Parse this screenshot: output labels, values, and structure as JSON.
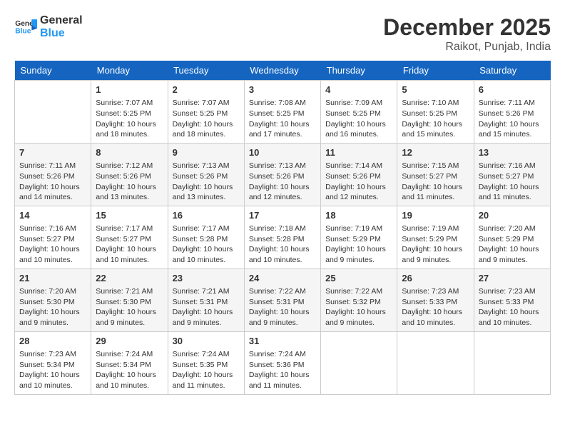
{
  "header": {
    "logo_line1": "General",
    "logo_line2": "Blue",
    "month": "December 2025",
    "location": "Raikot, Punjab, India"
  },
  "weekdays": [
    "Sunday",
    "Monday",
    "Tuesday",
    "Wednesday",
    "Thursday",
    "Friday",
    "Saturday"
  ],
  "weeks": [
    [
      {
        "day": "",
        "info": ""
      },
      {
        "day": "1",
        "info": "Sunrise: 7:07 AM\nSunset: 5:25 PM\nDaylight: 10 hours\nand 18 minutes."
      },
      {
        "day": "2",
        "info": "Sunrise: 7:07 AM\nSunset: 5:25 PM\nDaylight: 10 hours\nand 18 minutes."
      },
      {
        "day": "3",
        "info": "Sunrise: 7:08 AM\nSunset: 5:25 PM\nDaylight: 10 hours\nand 17 minutes."
      },
      {
        "day": "4",
        "info": "Sunrise: 7:09 AM\nSunset: 5:25 PM\nDaylight: 10 hours\nand 16 minutes."
      },
      {
        "day": "5",
        "info": "Sunrise: 7:10 AM\nSunset: 5:25 PM\nDaylight: 10 hours\nand 15 minutes."
      },
      {
        "day": "6",
        "info": "Sunrise: 7:11 AM\nSunset: 5:26 PM\nDaylight: 10 hours\nand 15 minutes."
      }
    ],
    [
      {
        "day": "7",
        "info": "Sunrise: 7:11 AM\nSunset: 5:26 PM\nDaylight: 10 hours\nand 14 minutes."
      },
      {
        "day": "8",
        "info": "Sunrise: 7:12 AM\nSunset: 5:26 PM\nDaylight: 10 hours\nand 13 minutes."
      },
      {
        "day": "9",
        "info": "Sunrise: 7:13 AM\nSunset: 5:26 PM\nDaylight: 10 hours\nand 13 minutes."
      },
      {
        "day": "10",
        "info": "Sunrise: 7:13 AM\nSunset: 5:26 PM\nDaylight: 10 hours\nand 12 minutes."
      },
      {
        "day": "11",
        "info": "Sunrise: 7:14 AM\nSunset: 5:26 PM\nDaylight: 10 hours\nand 12 minutes."
      },
      {
        "day": "12",
        "info": "Sunrise: 7:15 AM\nSunset: 5:27 PM\nDaylight: 10 hours\nand 11 minutes."
      },
      {
        "day": "13",
        "info": "Sunrise: 7:16 AM\nSunset: 5:27 PM\nDaylight: 10 hours\nand 11 minutes."
      }
    ],
    [
      {
        "day": "14",
        "info": "Sunrise: 7:16 AM\nSunset: 5:27 PM\nDaylight: 10 hours\nand 10 minutes."
      },
      {
        "day": "15",
        "info": "Sunrise: 7:17 AM\nSunset: 5:27 PM\nDaylight: 10 hours\nand 10 minutes."
      },
      {
        "day": "16",
        "info": "Sunrise: 7:17 AM\nSunset: 5:28 PM\nDaylight: 10 hours\nand 10 minutes."
      },
      {
        "day": "17",
        "info": "Sunrise: 7:18 AM\nSunset: 5:28 PM\nDaylight: 10 hours\nand 10 minutes."
      },
      {
        "day": "18",
        "info": "Sunrise: 7:19 AM\nSunset: 5:29 PM\nDaylight: 10 hours\nand 9 minutes."
      },
      {
        "day": "19",
        "info": "Sunrise: 7:19 AM\nSunset: 5:29 PM\nDaylight: 10 hours\nand 9 minutes."
      },
      {
        "day": "20",
        "info": "Sunrise: 7:20 AM\nSunset: 5:29 PM\nDaylight: 10 hours\nand 9 minutes."
      }
    ],
    [
      {
        "day": "21",
        "info": "Sunrise: 7:20 AM\nSunset: 5:30 PM\nDaylight: 10 hours\nand 9 minutes."
      },
      {
        "day": "22",
        "info": "Sunrise: 7:21 AM\nSunset: 5:30 PM\nDaylight: 10 hours\nand 9 minutes."
      },
      {
        "day": "23",
        "info": "Sunrise: 7:21 AM\nSunset: 5:31 PM\nDaylight: 10 hours\nand 9 minutes."
      },
      {
        "day": "24",
        "info": "Sunrise: 7:22 AM\nSunset: 5:31 PM\nDaylight: 10 hours\nand 9 minutes."
      },
      {
        "day": "25",
        "info": "Sunrise: 7:22 AM\nSunset: 5:32 PM\nDaylight: 10 hours\nand 9 minutes."
      },
      {
        "day": "26",
        "info": "Sunrise: 7:23 AM\nSunset: 5:33 PM\nDaylight: 10 hours\nand 10 minutes."
      },
      {
        "day": "27",
        "info": "Sunrise: 7:23 AM\nSunset: 5:33 PM\nDaylight: 10 hours\nand 10 minutes."
      }
    ],
    [
      {
        "day": "28",
        "info": "Sunrise: 7:23 AM\nSunset: 5:34 PM\nDaylight: 10 hours\nand 10 minutes."
      },
      {
        "day": "29",
        "info": "Sunrise: 7:24 AM\nSunset: 5:34 PM\nDaylight: 10 hours\nand 10 minutes."
      },
      {
        "day": "30",
        "info": "Sunrise: 7:24 AM\nSunset: 5:35 PM\nDaylight: 10 hours\nand 11 minutes."
      },
      {
        "day": "31",
        "info": "Sunrise: 7:24 AM\nSunset: 5:36 PM\nDaylight: 10 hours\nand 11 minutes."
      },
      {
        "day": "",
        "info": ""
      },
      {
        "day": "",
        "info": ""
      },
      {
        "day": "",
        "info": ""
      }
    ]
  ]
}
